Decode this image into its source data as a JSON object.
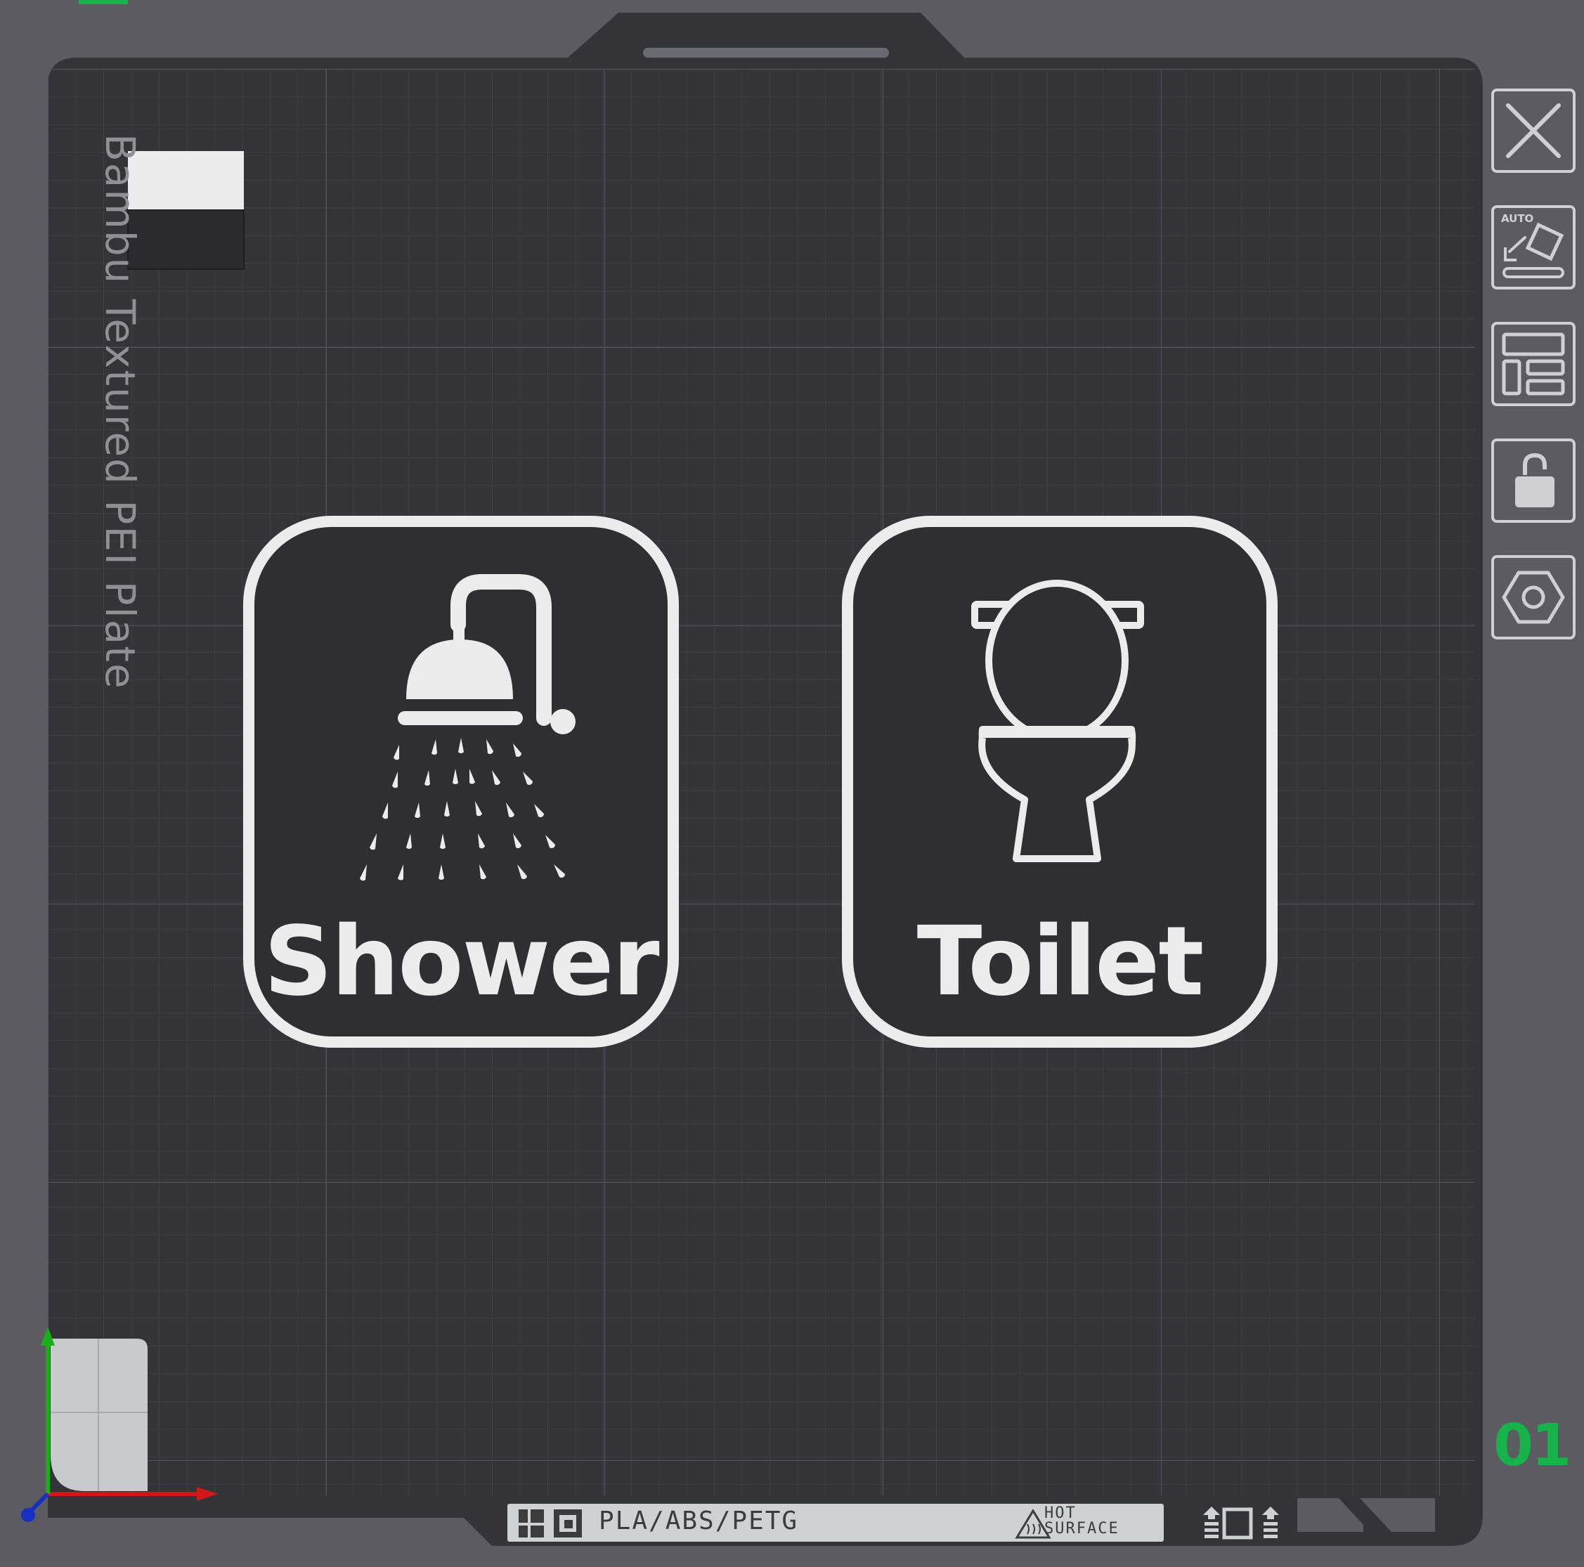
{
  "bed": {
    "label": "Bambu Textured PEI Plate",
    "material_text": "PLA/ABS/PETG",
    "hot_surface_line1": "HOT",
    "hot_surface_line2": "SURFACE",
    "plate_number": "01"
  },
  "signs": [
    {
      "label": "Shower",
      "icon": "shower-icon"
    },
    {
      "label": "Toilet",
      "icon": "toilet-icon"
    }
  ],
  "toolbar": {
    "items": [
      {
        "name": "close-plate-button",
        "icon": "close-icon"
      },
      {
        "name": "auto-orient-button",
        "icon": "auto-orient-icon",
        "badge": "AUTO"
      },
      {
        "name": "arrange-button",
        "icon": "arrange-icon"
      },
      {
        "name": "lock-plate-button",
        "icon": "unlock-icon"
      },
      {
        "name": "plate-settings-button",
        "icon": "hex-settings-icon"
      }
    ]
  },
  "colors": {
    "background": "#5b5b61",
    "bed": "#333338",
    "sign_fill": "#2f2f32",
    "sign_stroke": "#ececec",
    "plate_number": "#16b34a",
    "axis_x": "#d01818",
    "axis_y": "#18b018",
    "axis_z": "#1830c0"
  }
}
